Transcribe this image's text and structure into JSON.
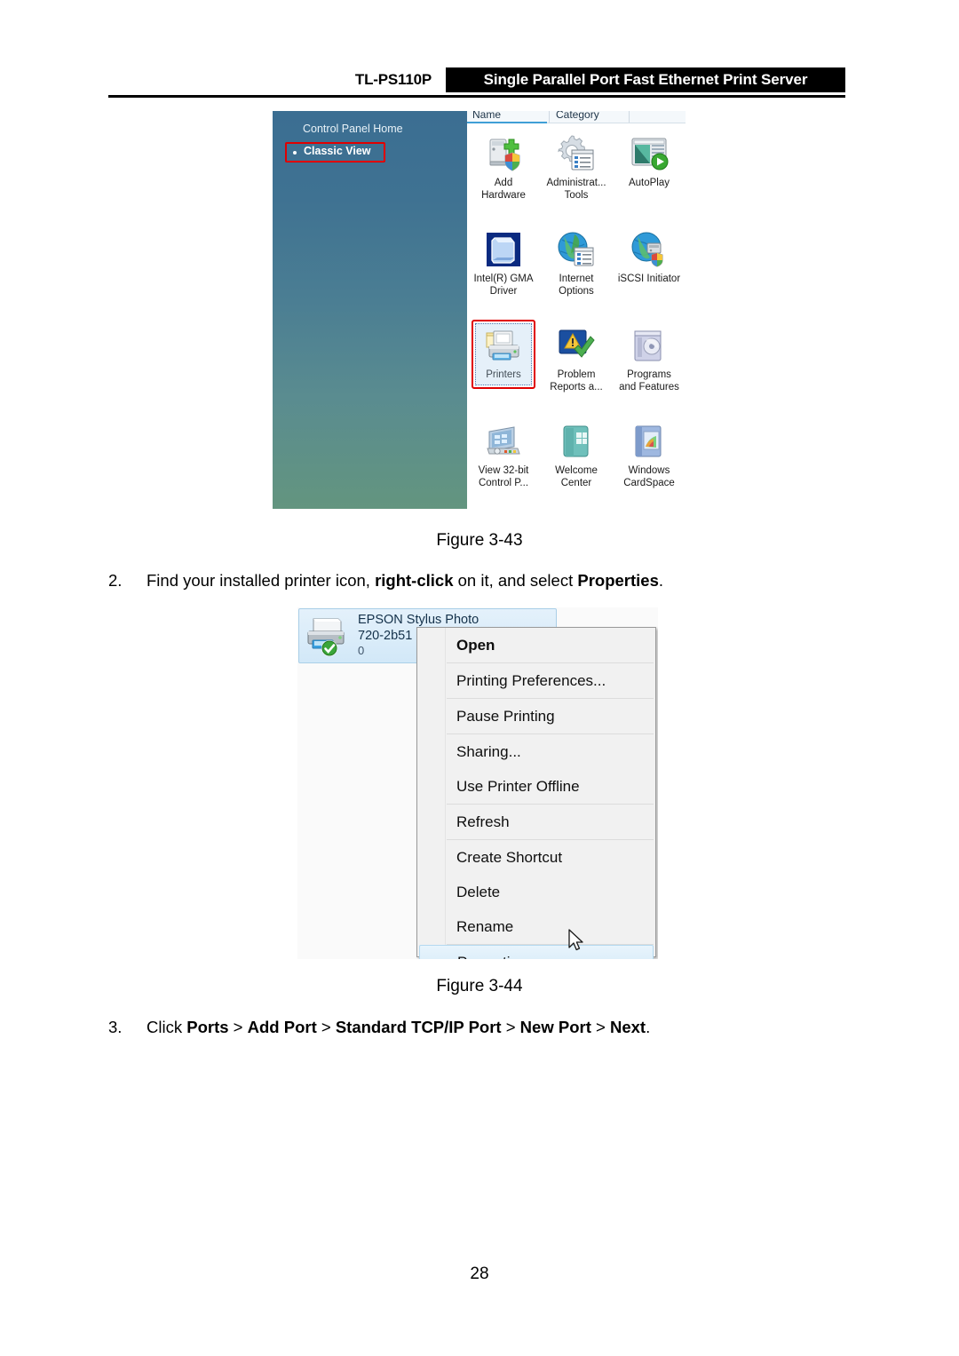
{
  "header": {
    "model": "TL-PS110P",
    "banner_title": "Single Parallel Port Fast Ethernet Print Server"
  },
  "figure_3_43": {
    "caption": "Figure 3-43",
    "control_panel": {
      "sidebar": {
        "home_label": "Control Panel Home",
        "classic_view_label": "Classic View"
      },
      "columns": [
        "Name",
        "Category"
      ],
      "items": [
        {
          "label": "Add\nHardware",
          "icon": "add-hardware-icon",
          "selected": false
        },
        {
          "label": "Administrat...\nTools",
          "icon": "administrative-tools-icon",
          "selected": false
        },
        {
          "label": "AutoPlay",
          "icon": "autoplay-icon",
          "selected": false
        },
        {
          "label": "Intel(R) GMA\nDriver",
          "icon": "intel-gma-driver-icon",
          "selected": false
        },
        {
          "label": "Internet\nOptions",
          "icon": "internet-options-icon",
          "selected": false
        },
        {
          "label": "iSCSI Initiator",
          "icon": "iscsi-initiator-icon",
          "selected": false
        },
        {
          "label": "Printers",
          "icon": "printers-icon",
          "selected": true
        },
        {
          "label": "Problem\nReports a...",
          "icon": "problem-reports-icon",
          "selected": false
        },
        {
          "label": "Programs\nand Features",
          "icon": "programs-and-features-icon",
          "selected": false
        },
        {
          "label": "View 32-bit\nControl P...",
          "icon": "view-32bit-control-panel-icon",
          "selected": false
        },
        {
          "label": "Welcome\nCenter",
          "icon": "welcome-center-icon",
          "selected": false
        },
        {
          "label": "Windows\nCardSpace",
          "icon": "windows-cardspace-icon",
          "selected": false
        }
      ]
    }
  },
  "step_2": {
    "number": "2.",
    "part1": "Find your installed printer icon, ",
    "bold1": "right-click",
    "part2": " on it, and select ",
    "bold2": "Properties",
    "part3": "."
  },
  "figure_3_44": {
    "caption": "Figure 3-44",
    "printer": {
      "name": "EPSON Stylus Photo\n720-2b51",
      "queue_count": "0",
      "icon": "printer-default-icon"
    },
    "context_menu": [
      {
        "label": "Open",
        "bold": true,
        "highlighted": false,
        "separator_after": true
      },
      {
        "label": "Printing Preferences...",
        "bold": false,
        "highlighted": false,
        "separator_after": true
      },
      {
        "label": "Pause Printing",
        "bold": false,
        "highlighted": false,
        "separator_after": true
      },
      {
        "label": "Sharing...",
        "bold": false,
        "highlighted": false,
        "separator_after": false
      },
      {
        "label": "Use Printer Offline",
        "bold": false,
        "highlighted": false,
        "separator_after": true
      },
      {
        "label": "Refresh",
        "bold": false,
        "highlighted": false,
        "separator_after": true
      },
      {
        "label": "Create Shortcut",
        "bold": false,
        "highlighted": false,
        "separator_after": false
      },
      {
        "label": "Delete",
        "bold": false,
        "highlighted": false,
        "separator_after": false
      },
      {
        "label": "Rename",
        "bold": false,
        "highlighted": false,
        "separator_after": true
      },
      {
        "label": "Properties",
        "bold": false,
        "highlighted": true,
        "separator_after": false
      }
    ]
  },
  "step_3": {
    "number": "3.",
    "part1": "Click ",
    "bold1": "Ports",
    "sep1": " > ",
    "bold2": "Add Port",
    "sep2": " > ",
    "bold3": "Standard TCP/IP Port",
    "sep3": " > ",
    "bold4": "New Port",
    "sep4": " > ",
    "bold5": "Next",
    "part_end": "."
  },
  "page_number": "28",
  "colors": {
    "banner_bg": "#000000",
    "banner_text": "#ffffff",
    "highlight_red": "#e00000",
    "sidebar_top": "#3b6e92",
    "sidebar_bottom": "#63957f",
    "menu_bg": "#f1f1f1",
    "tile_selected": "#d2e8f8"
  }
}
